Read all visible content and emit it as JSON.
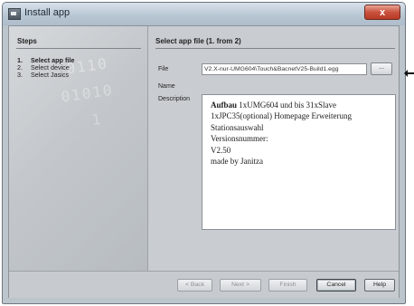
{
  "window": {
    "title": "Install app",
    "close_symbol": "x",
    "icon": "app-window-icon"
  },
  "steps": {
    "heading": "Steps",
    "items": [
      {
        "num": "1.",
        "label": "Select app file",
        "active": true
      },
      {
        "num": "2.",
        "label": "Select device",
        "active": false
      },
      {
        "num": "3.",
        "label": "Select Jasics",
        "active": false
      }
    ]
  },
  "content": {
    "heading": "Select app file (1. from 2)",
    "file_label": "File",
    "file_value": "V2.X-nur-UMG604\\Touch&BacnetV25-Build1.egg",
    "browse_label": "...",
    "name_label": "Name",
    "description_label": "Description",
    "description": {
      "line1_bold": "Aufbau",
      "line1_rest": " 1xUMG604 und bis 31xSlave",
      "line2": "1xJPC35(optional) Homepage Erweiterung",
      "line3": "Stationsauswahl",
      "line4": "Versionsnummer:",
      "line5": "V2.50",
      "line6": "made by Janitza"
    }
  },
  "buttons": {
    "back": "< Back",
    "next": "Next >",
    "finish": "Finish",
    "cancel": "Cancel",
    "help": "Help"
  },
  "colors": {
    "title_bar": "#b9c7d4",
    "close_button": "#c9523e",
    "panel": "#c9cdd1"
  }
}
